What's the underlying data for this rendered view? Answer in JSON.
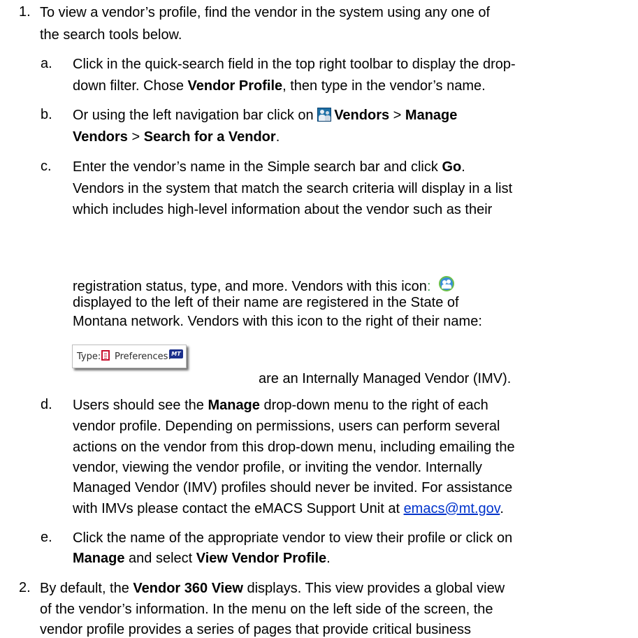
{
  "step1": {
    "number": "1.",
    "line1": "To view a vendor’s profile, find the vendor in the system using any one of",
    "line2": "the search tools below."
  },
  "a": {
    "letter": "a.",
    "line1": "Click in the quick-search field in the top right toolbar to display the drop-",
    "line2_pre": "down filter. Chose ",
    "line2_bold": "Vendor Profile",
    "line2_post": ", then type in the vendor’s name."
  },
  "b": {
    "letter": "b.",
    "line1_pre": "Or using the left navigation bar click on ",
    "icon": "vendors-icon",
    "line1_bold1": "Vendors",
    "sep1": " > ",
    "line1_bold2": "Manage",
    "line2_bold1": "Vendors",
    "sep2": " > ",
    "line2_bold2": "Search for a Vendor",
    "line2_post": "."
  },
  "c": {
    "letter": "c.",
    "line1_pre": "Enter the vendor’s name in the Simple search bar and click ",
    "line1_bold": "Go",
    "line1_post": ".",
    "line2": "Vendors in the system that match the search criteria will display in a list",
    "line3": "which includes high-level information about the vendor such as their",
    "line4_pre": "registration status, type, and more. Vendors with this icon",
    "line4_colon": ":",
    "registered_icon": "registered-vendor-icon",
    "line5": "displayed to the left of their name are registered in the State of",
    "line6": "Montana network. Vendors with this icon to the right of their name:",
    "type_label": "Type:",
    "type_icon": "document-type-icon",
    "preferences_label": "Preferences:",
    "preferences_badge": "MT",
    "line7": "are an Internally Managed Vendor (IMV)."
  },
  "d": {
    "letter": "d.",
    "line1_pre": "Users should see the ",
    "line1_bold": "Manage",
    "line1_post": " drop-down menu to the right of each",
    "line2": "vendor profile. Depending on permissions, users can perform several",
    "line3": "actions on the vendor from this drop-down menu, including emailing the",
    "line4": "vendor, viewing the vendor profile, or inviting the vendor. Internally",
    "line5": "Managed Vendor (IMV) profiles should never be invited. For assistance",
    "line6_pre": "with IMVs please contact the eMACS Support Unit at ",
    "line6_link": "emacs@mt.gov",
    "line6_post": "."
  },
  "e": {
    "letter": "e.",
    "line1": "Click the name of the appropriate vendor to view their profile or click on",
    "line2_bold1": "Manage",
    "line2_mid": " and select ",
    "line2_bold2": "View Vendor Profile",
    "line2_post": "."
  },
  "step2": {
    "number": "2.",
    "line1_pre": "By default, the ",
    "line1_bold": "Vendor 360 View",
    "line1_post": " displays. This view provides a global view",
    "line2": "of the vendor’s information. In the menu on the left side of the screen, the",
    "line3": "vendor profile provides a series of pages that provide critical business"
  },
  "colors": {
    "link": "#0033cc",
    "network_icon_ring": "#6bc04b",
    "mt_badge": "#1b2f8c"
  }
}
